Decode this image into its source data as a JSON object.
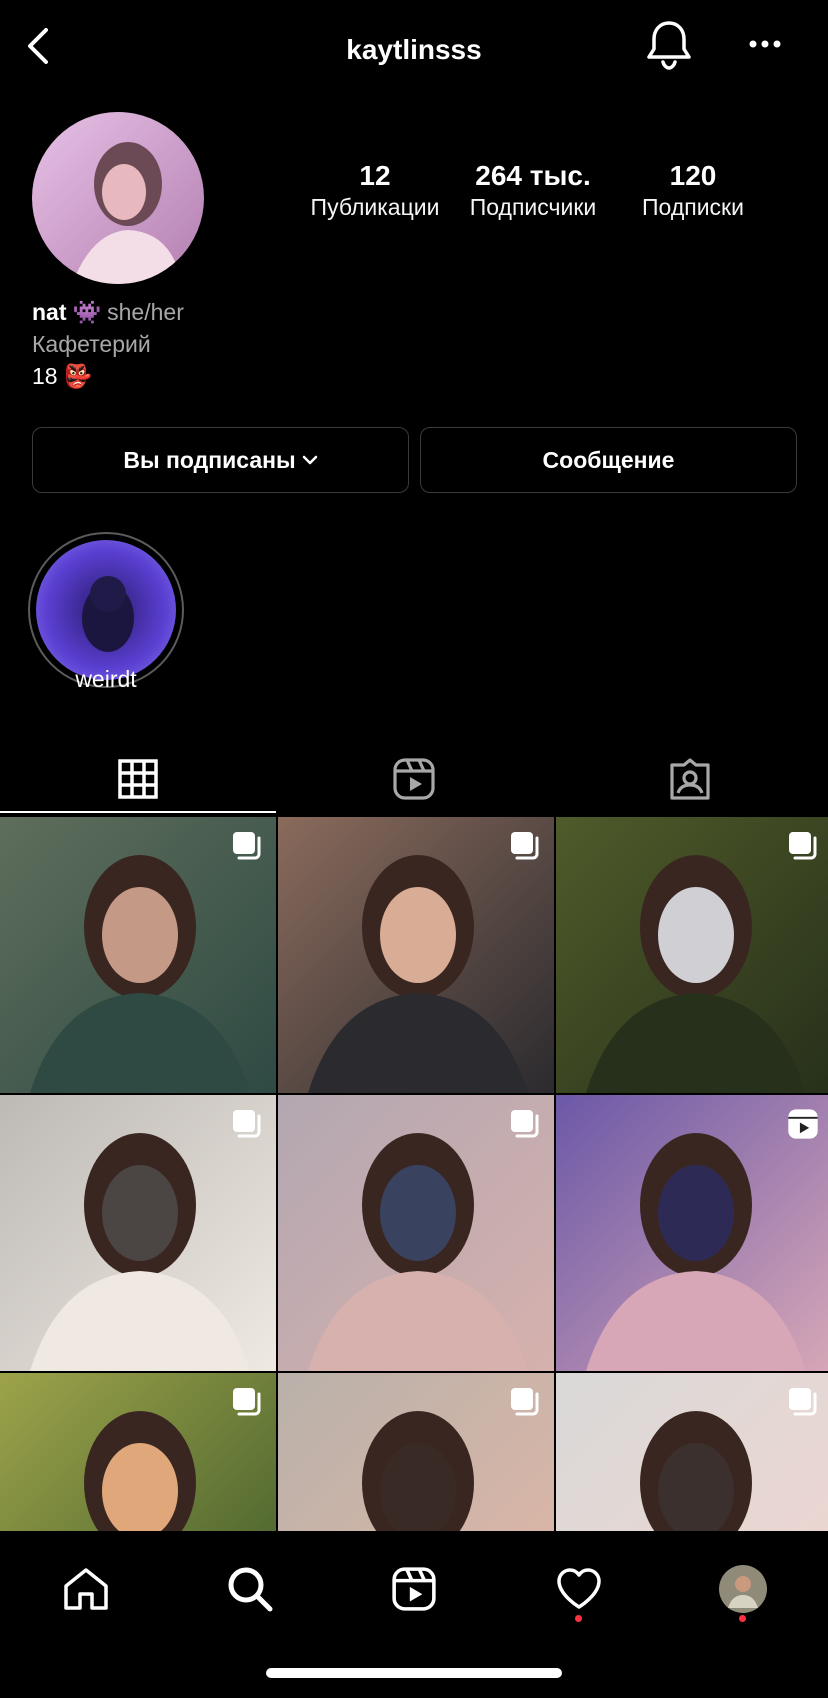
{
  "header": {
    "username": "kaytlinsss"
  },
  "stats": [
    {
      "value": "12",
      "label": "Публикации"
    },
    {
      "value": "264 тыс.",
      "label": "Подписчики"
    },
    {
      "value": "120",
      "label": "Подписки"
    }
  ],
  "bio": {
    "name": "nat",
    "name_emoji": "👾",
    "pronouns": "she/her",
    "category": "Кафетерий",
    "line3": "18",
    "line3_emoji": "👺"
  },
  "actions": {
    "following_label": "Вы подписаны",
    "message_label": "Сообщение"
  },
  "highlights": [
    {
      "label": "weirdt"
    }
  ],
  "tabs": [
    {
      "icon": "grid-icon",
      "active": true
    },
    {
      "icon": "reels-icon",
      "active": false
    },
    {
      "icon": "tagged-icon",
      "active": false
    }
  ],
  "posts": [
    {
      "badge": "carousel-icon",
      "colors": [
        "#5f6e5c",
        "#c49a86",
        "#2e4a43"
      ]
    },
    {
      "badge": "carousel-icon",
      "colors": [
        "#8a6b5c",
        "#d9ad95",
        "#2b2a2e"
      ]
    },
    {
      "badge": "carousel-icon",
      "colors": [
        "#4f5b2a",
        "#cfcfd4",
        "#27301a"
      ]
    },
    {
      "badge": "carousel-icon",
      "colors": [
        "#bdb9b4",
        "#4b4544",
        "#efe9e2"
      ]
    },
    {
      "badge": "carousel-icon",
      "colors": [
        "#b3a7b1",
        "#39425e",
        "#d6b1ad"
      ]
    },
    {
      "badge": "reels-icon",
      "colors": [
        "#6b58a7",
        "#2d2b55",
        "#d7a7b7"
      ]
    },
    {
      "badge": "carousel-icon",
      "colors": [
        "#9da34a",
        "#e0a77a",
        "#3f5b2a"
      ]
    },
    {
      "badge": "carousel-icon",
      "colors": [
        "#b9b1aa",
        "#3a2a25",
        "#e1b7a6"
      ]
    },
    {
      "badge": "carousel-icon",
      "colors": [
        "#d9d9d8",
        "#3b302d",
        "#f0d5cf"
      ]
    }
  ],
  "nav": {
    "items": [
      "home-icon",
      "search-icon",
      "reels-icon",
      "activity-icon",
      "profile-avatar"
    ],
    "accent": "#ff3040"
  }
}
